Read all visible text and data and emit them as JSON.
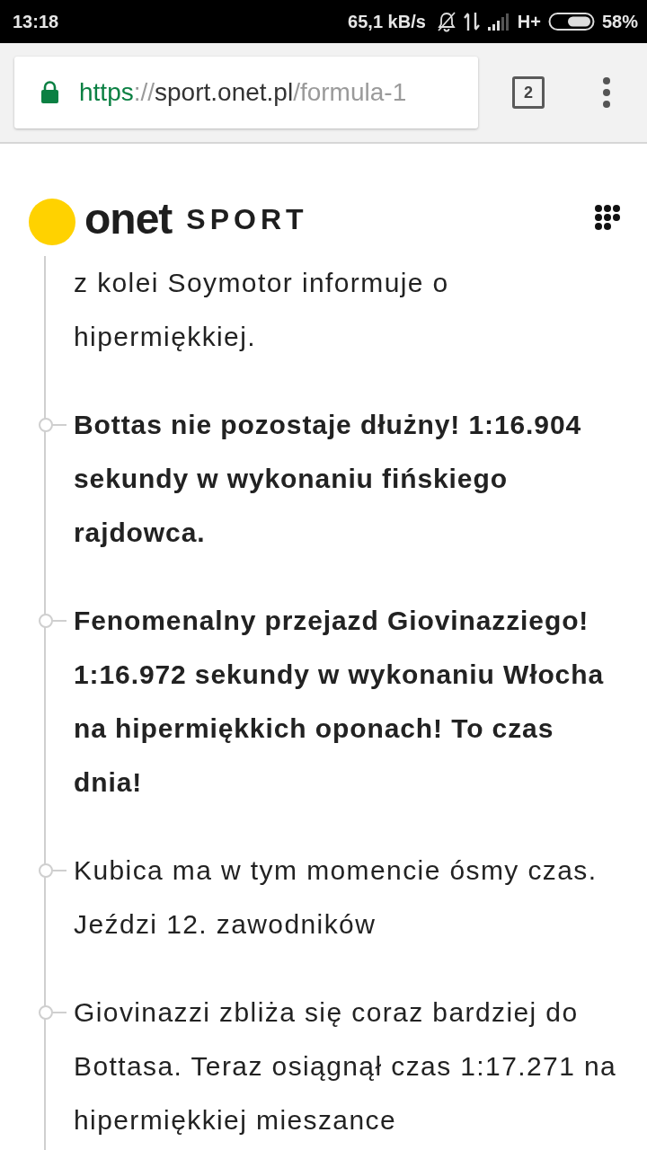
{
  "status_bar": {
    "time": "13:18",
    "speed": "65,1 kB/s",
    "network": "H+",
    "battery": "58%"
  },
  "browser_toolbar": {
    "url": {
      "scheme": "https",
      "separator": "://",
      "host": "sport.onet.pl",
      "path": "/formula-1"
    },
    "tab_count": "2"
  },
  "site_header": {
    "logo": {
      "brand": "onet",
      "section": "SPORT"
    }
  },
  "timeline": [
    {
      "kind": "continued",
      "bold": false,
      "text": "z kolei Soymotor informuje o hipermiękkiej."
    },
    {
      "kind": "entry",
      "bold": true,
      "text": "Bottas nie pozostaje dłużny! 1:16.904 sekundy w wykonaniu fińskiego rajdowca."
    },
    {
      "kind": "entry",
      "bold": true,
      "text": "Fenomenalny przejazd Giovinazziego! 1:16.972 sekundy w wykonaniu Włocha na hipermiękkich oponach! To czas dnia!"
    },
    {
      "kind": "entry",
      "bold": false,
      "text": "Kubica ma w tym momencie ósmy czas. Jeździ 12. zawodników"
    },
    {
      "kind": "entry",
      "bold": false,
      "text": "Giovinazzi zbliża się coraz bardziej do Bottasa. Teraz osiągnął czas 1:17.271 na hipermiękkiej mieszance"
    }
  ]
}
